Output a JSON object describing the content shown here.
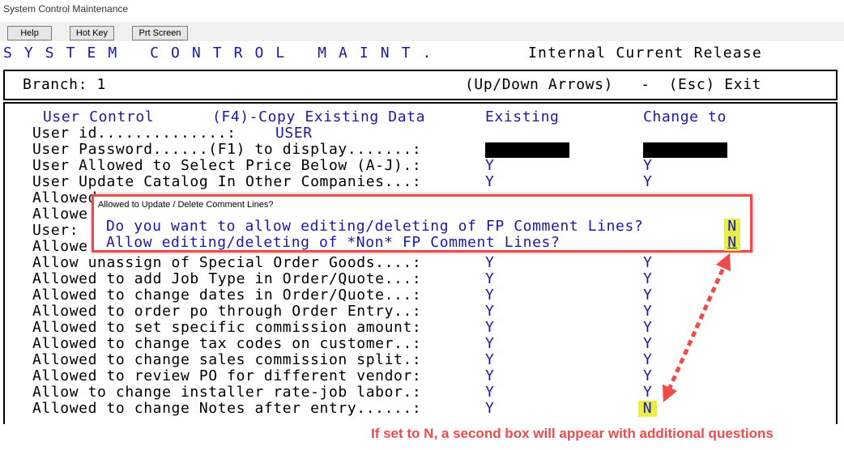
{
  "window": {
    "title": "System Control Maintenance"
  },
  "toolbar": {
    "help": "Help",
    "hotkey": "Hot Key",
    "prtscreen": "Prt Screen"
  },
  "header": {
    "title": "S Y S T E M   C O N T R O L   M A I N T .",
    "release": "Internal Current Release"
  },
  "branch_bar": {
    "branch": "Branch: 1",
    "hint": "(Up/Down Arrows)   -  (Esc) Exit"
  },
  "form": {
    "section_title": "User Control",
    "copy_hint": "(F4)-Copy Existing Data",
    "col_existing": "Existing",
    "col_change": "Change to",
    "user_id_label": "User id..............:",
    "user_id_value": "USER",
    "password_label": "User Password......(F1) to display.......:",
    "rows": [
      {
        "label": "User Allowed to Select Price Below (A-J).:",
        "existing": "Y",
        "change": "Y"
      },
      {
        "label": "User Update Catalog In Other Companies...:",
        "existing": "Y",
        "change": "Y"
      },
      {
        "label": "Allowed",
        "existing": "",
        "change": ""
      },
      {
        "label": "Allowe",
        "existing": "",
        "change": ""
      },
      {
        "label": "User:",
        "existing": "",
        "change": ""
      },
      {
        "label": "Allowe",
        "existing": "",
        "change": ""
      },
      {
        "label": "Allow unassign of Special Order Goods....:",
        "existing": "Y",
        "change": "Y"
      },
      {
        "label": "Allowed to add Job Type in Order/Quote...:",
        "existing": "Y",
        "change": "Y"
      },
      {
        "label": "Allowed to change dates in Order/Quote...:",
        "existing": "Y",
        "change": "Y"
      },
      {
        "label": "Allowed to order po through Order Entry..:",
        "existing": "Y",
        "change": "Y"
      },
      {
        "label": "Allowed to set specific commission amount:",
        "existing": "Y",
        "change": "Y"
      },
      {
        "label": "Allowed to change tax codes on customer..:",
        "existing": "Y",
        "change": "Y"
      },
      {
        "label": "Allowed to change sales commission split.:",
        "existing": "Y",
        "change": "Y"
      },
      {
        "label": "Allowed to review PO for different vendor:",
        "existing": "Y",
        "change": "Y"
      },
      {
        "label": "Allow to change installer rate-job labor.:",
        "existing": "Y",
        "change": "Y"
      },
      {
        "label": "Allowed to change Notes after entry......:",
        "existing": "Y",
        "change": "N"
      }
    ]
  },
  "dialog": {
    "title": "Allowed to Update / Delete Comment Lines?",
    "q1": "Do you want to allow editing/deleting of FP Comment Lines?",
    "a1": "N",
    "q2": "Allow editing/deleting of *Non* FP Comment Lines?",
    "a2": "N"
  },
  "annotation": {
    "caption": "If set to N, a second box will appear with additional questions",
    "color": "#f04a4a"
  },
  "colors": {
    "terminal_blue": "#1a1aa6",
    "highlight": "#e9ec4a"
  }
}
